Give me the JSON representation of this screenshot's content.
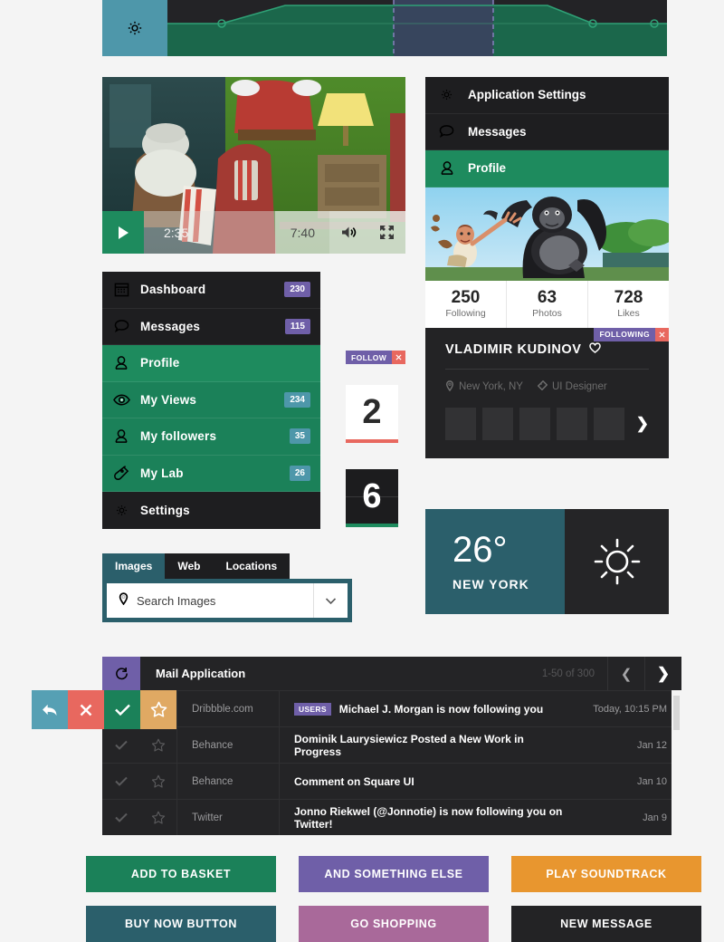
{
  "chart": {
    "gear_icon": "gear-icon",
    "accent_green": "#1e8b5e",
    "accent_teal": "#4e97aa",
    "selection_border": "#8d84c4",
    "background": "#232326"
  },
  "chart_data": {
    "type": "area",
    "title": "",
    "x": [
      0,
      1,
      2,
      3,
      4,
      5,
      6
    ],
    "values": [
      18,
      40,
      40,
      40,
      40,
      18,
      18
    ],
    "markers": [
      1,
      5,
      6
    ],
    "selection": [
      3,
      4
    ],
    "grid": false,
    "legend": "none"
  },
  "video": {
    "play_icon": "play-icon",
    "current_time": "2:35",
    "total_time": "7:40",
    "volume_icon": "volume-icon",
    "fullscreen_icon": "fullscreen-icon"
  },
  "menu": {
    "items": [
      {
        "icon": "calendar-icon",
        "label": "Dashboard",
        "badge": "230",
        "badge_color": "purple",
        "state": "dark"
      },
      {
        "icon": "chat-icon",
        "label": "Messages",
        "badge": "115",
        "badge_color": "purple",
        "state": "dark"
      },
      {
        "icon": "user-icon",
        "label": "Profile",
        "badge": "",
        "badge_color": "",
        "state": "green"
      },
      {
        "icon": "eye-icon",
        "label": "My Views",
        "badge": "234",
        "badge_color": "blue",
        "state": "green-d"
      },
      {
        "icon": "user-icon",
        "label": "My followers",
        "badge": "35",
        "badge_color": "blue",
        "state": "green-d"
      },
      {
        "icon": "flask-icon",
        "label": "My Lab",
        "badge": "26",
        "badge_color": "blue",
        "state": "green-d"
      },
      {
        "icon": "gear-icon",
        "label": "Settings",
        "badge": "",
        "badge_color": "",
        "state": "dark"
      }
    ]
  },
  "follow": {
    "label": "FOLLOW",
    "close_icon": "close-icon"
  },
  "counters": [
    {
      "value": "2",
      "theme": "light"
    },
    {
      "value": "6",
      "theme": "dark"
    }
  ],
  "right_panel": {
    "items": [
      {
        "icon": "gear-icon",
        "label": "Application Settings",
        "state": "dark"
      },
      {
        "icon": "chat-icon",
        "label": "Messages",
        "state": "dark"
      },
      {
        "icon": "user-icon",
        "label": "Profile",
        "state": "green"
      }
    ],
    "cover_alt": "gorilla-illustration",
    "stats": [
      {
        "value": "250",
        "label": "Following"
      },
      {
        "value": "63",
        "label": "Photos"
      },
      {
        "value": "728",
        "label": "Likes"
      }
    ],
    "flag_label": "FOLLOWING",
    "flag_close_icon": "close-icon",
    "name": "VLADIMIR KUDINOV",
    "heart_icon": "heart-icon",
    "location": "New York, NY",
    "location_icon": "pin-icon",
    "role": "UI Designer",
    "role_icon": "tag-icon",
    "thumb_count": 5,
    "next_icon": "chevron-right-icon"
  },
  "weather": {
    "temperature": "26°",
    "city": "NEW YORK",
    "condition_icon": "sun-icon"
  },
  "search": {
    "tabs": [
      {
        "label": "Images",
        "active": true
      },
      {
        "label": "Web",
        "active": false
      },
      {
        "label": "Locations",
        "active": false
      }
    ],
    "placeholder": "Search Images",
    "value": "",
    "pin_icon": "pin-icon",
    "caret_icon": "chevron-down-icon"
  },
  "mail": {
    "refresh_icon": "refresh-icon",
    "title": "Mail Application",
    "count": "1-50 of 300",
    "prev_icon": "chevron-left-icon",
    "next_icon": "chevron-right-icon",
    "actions": [
      {
        "icon": "reply-icon",
        "color": "#56a0b4"
      },
      {
        "icon": "close-icon",
        "color": "#e8685f"
      },
      {
        "icon": "check-icon",
        "color": "#1b8159"
      },
      {
        "icon": "star-icon",
        "color": "#e0a963"
      }
    ],
    "rows": [
      {
        "source": "Dribbble.com",
        "tag": "USERS",
        "subject": "Michael J. Morgan is now following you",
        "date": "Today, 10:15 PM",
        "active": true
      },
      {
        "source": "Behance",
        "tag": "",
        "subject": "Dominik Laurysiewicz Posted a New Work in Progress",
        "date": "Jan 12",
        "active": false
      },
      {
        "source": "Behance",
        "tag": "",
        "subject": "Comment on Square UI",
        "date": "Jan 10",
        "active": false
      },
      {
        "source": "Twitter",
        "tag": "",
        "subject": "Jonno Riekwel (@Jonnotie) is now following you on Twitter!",
        "date": "Jan 9",
        "active": false
      }
    ]
  },
  "buttons": [
    {
      "label": "ADD TO BASKET",
      "color": "#1b8159"
    },
    {
      "label": "AND SOMETHING ELSE",
      "color": "#6f5fa8"
    },
    {
      "label": "PLAY SOUNDTRACK",
      "color": "#e8962f"
    },
    {
      "label": "BUY NOW BUTTON",
      "color": "#2b5f6b"
    },
    {
      "label": "GO SHOPPING",
      "color": "#a9699a"
    },
    {
      "label": "NEW MESSAGE",
      "color": "#232325"
    }
  ]
}
